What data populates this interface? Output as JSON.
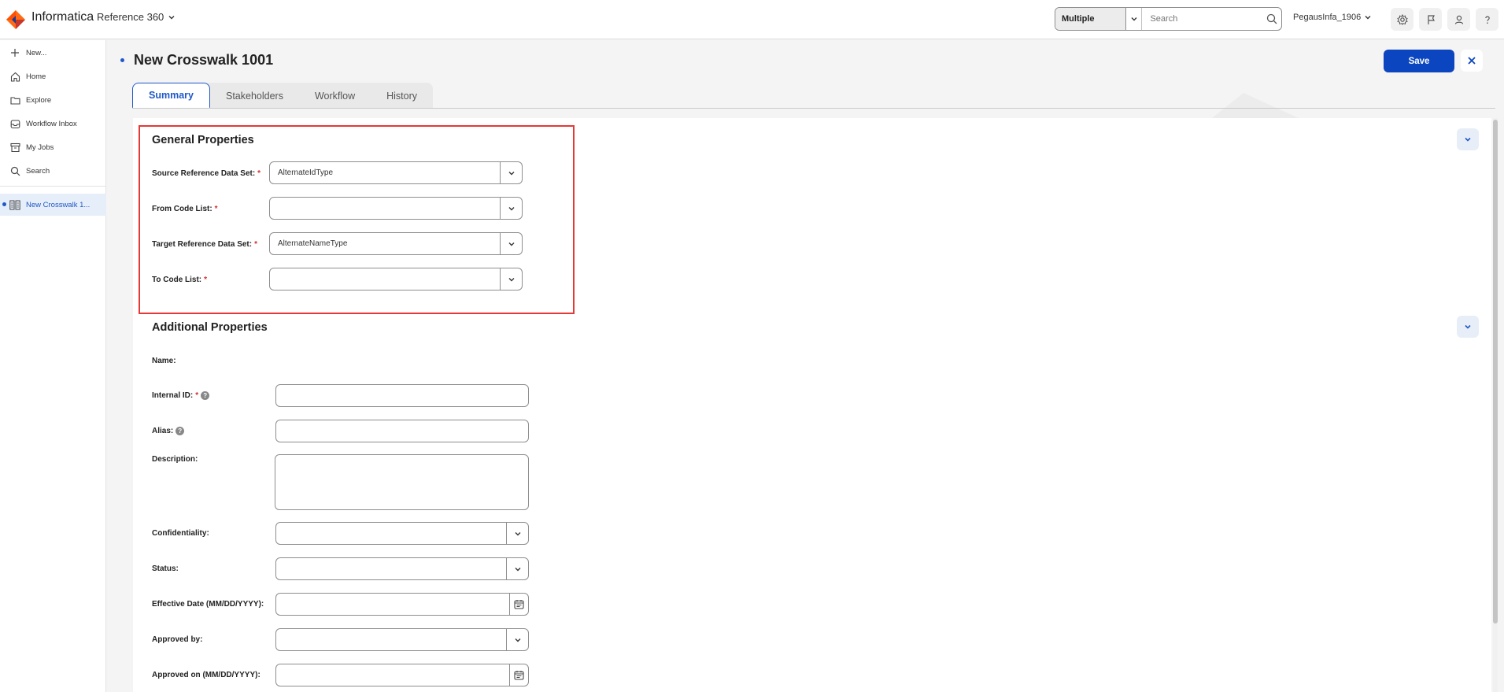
{
  "header": {
    "brand": "Informatica",
    "app": "Reference 360",
    "search_scope": "Multiple",
    "search_placeholder": "Search",
    "user": "PegausInfa_1906"
  },
  "sidebar": {
    "items": [
      {
        "label": "New...",
        "icon": "plus-icon"
      },
      {
        "label": "Home",
        "icon": "home-icon"
      },
      {
        "label": "Explore",
        "icon": "folder-icon"
      },
      {
        "label": "Workflow Inbox",
        "icon": "inbox-icon"
      },
      {
        "label": "My Jobs",
        "icon": "archive-icon"
      },
      {
        "label": "Search",
        "icon": "search-icon"
      }
    ],
    "open_tab": "New Crosswalk 1..."
  },
  "page": {
    "title": "New Crosswalk 1001",
    "save_label": "Save",
    "tabs": [
      "Summary",
      "Stakeholders",
      "Workflow",
      "History"
    ],
    "active_tab": "Summary"
  },
  "general": {
    "title": "General Properties",
    "source_ref_label": "Source Reference Data Set:",
    "source_ref_value": "AlternateIdType",
    "from_code_label": "From Code List:",
    "from_code_value": "",
    "target_ref_label": "Target Reference Data Set:",
    "target_ref_value": "AlternateNameType",
    "to_code_label": "To Code List:",
    "to_code_value": ""
  },
  "additional": {
    "title": "Additional Properties",
    "name_label": "Name:",
    "internal_id_label": "Internal ID:",
    "alias_label": "Alias:",
    "description_label": "Description:",
    "confidentiality_label": "Confidentiality:",
    "status_label": "Status:",
    "effective_date_label": "Effective Date (MM/DD/YYYY):",
    "approved_by_label": "Approved by:",
    "approved_on_label": "Approved on (MM/DD/YYYY):"
  },
  "required_marker": "*",
  "help_glyph": "?",
  "colors": {
    "accent": "#0b45c0",
    "required": "#d32f2f",
    "highlight": "#e53935"
  }
}
